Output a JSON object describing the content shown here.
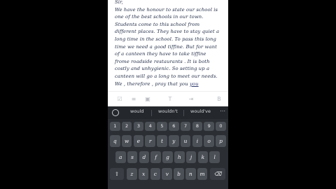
{
  "note": {
    "lines": [
      "Sir,",
      "We have the honour to state our school is",
      "one of the best schools in our town.",
      "Students come to this school from",
      "different places. They have to stay quiet a",
      "long time in the school. To pass this long",
      "time we need a good tiffine. But for want",
      "of a canteen they have to take tiffine",
      "frome roadside restaurants . It is both",
      "costly and unhygienic. So setting up a",
      "canteen will go a long to meet our needs.",
      "We , therefore , pray that you "
    ],
    "cursor_word": "you"
  },
  "format_bar": {
    "icons": [
      "checklist-icon",
      "list-icon",
      "image-icon",
      "text-format-icon",
      "indent-icon",
      "bold-icon"
    ],
    "glyphs": [
      "☑",
      "≡",
      "▣",
      "T",
      "⇥",
      "B"
    ]
  },
  "keyboard": {
    "suggestions": [
      "would",
      "wouldn't",
      "would've"
    ],
    "number_row": [
      "1",
      "2",
      "3",
      "4",
      "5",
      "6",
      "7",
      "8",
      "9",
      "0"
    ],
    "row1": [
      "q",
      "w",
      "e",
      "r",
      "t",
      "y",
      "u",
      "i",
      "o",
      "p"
    ],
    "row2": [
      "a",
      "s",
      "d",
      "f",
      "g",
      "h",
      "j",
      "k",
      "l"
    ],
    "row3": [
      "z",
      "x",
      "c",
      "v",
      "b",
      "n",
      "m"
    ],
    "shift_glyph": "⇧",
    "backspace_glyph": "⌫",
    "more_glyph": "⋯"
  },
  "colors": {
    "keyboard_bg": "#2b2e33",
    "key_bg": "#4b4f56",
    "text": "#1f2a44"
  }
}
